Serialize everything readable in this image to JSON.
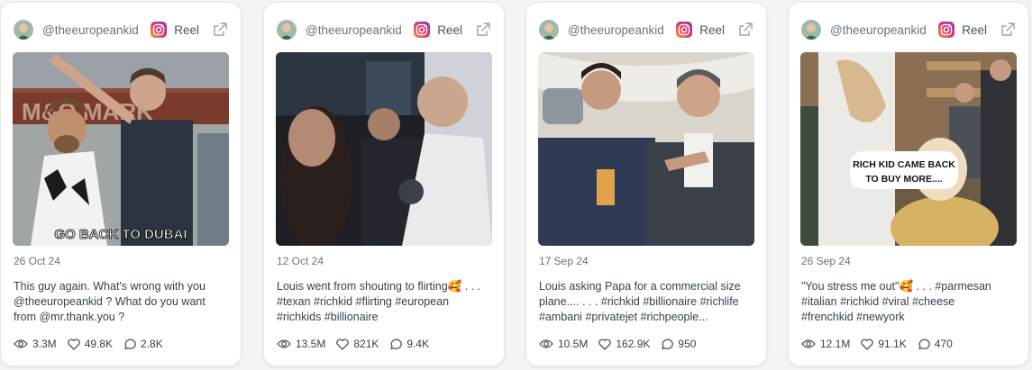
{
  "cards": [
    {
      "handle": "@theeuropeankid",
      "platform": "Reel",
      "date": "12 Oct 24",
      "caption_lines": [
        "Louis went from shouting to flirting🥰 . . .",
        "#texan #richkid #flirting #european",
        "#richkids #billionaire"
      ],
      "views": "13.5M",
      "likes": "821K",
      "comments": "9.4K",
      "overlay_text": ""
    },
    {
      "handle": "@theeuropeankid",
      "platform": "Reel",
      "date": "17 Sep 24",
      "caption_lines": [
        "Louis asking Papa for a commercial size",
        "plane.... . . . #richkid #billionaire #richlife",
        "#ambani #privatejet #richpeople..."
      ],
      "views": "10.5M",
      "likes": "162.9K",
      "comments": "950",
      "overlay_text": ""
    },
    {
      "handle": "@theeuropeankid",
      "platform": "Reel",
      "date": "26 Sep 24",
      "caption_lines": [
        "\"You stress me out\"🥰 . . . #parmesan",
        "#italian #richkid #viral #cheese",
        "#frenchkid #newyork"
      ],
      "views": "12.1M",
      "likes": "91.1K",
      "comments": "470",
      "overlay_text": "RICH KID CAME BACK TO BUY MORE...."
    },
    {
      "handle": "@theeuropeankid",
      "platform": "Reel",
      "date": "26 Oct 24",
      "caption_lines": [
        "This guy again. What's wrong with you",
        "@theeuropeankid ? What do you want",
        "from @mr.thank.you ?"
      ],
      "views": "3.3M",
      "likes": "49.8K",
      "comments": "2.8K",
      "overlay_text": "GO BACK TO DUBAI"
    }
  ]
}
